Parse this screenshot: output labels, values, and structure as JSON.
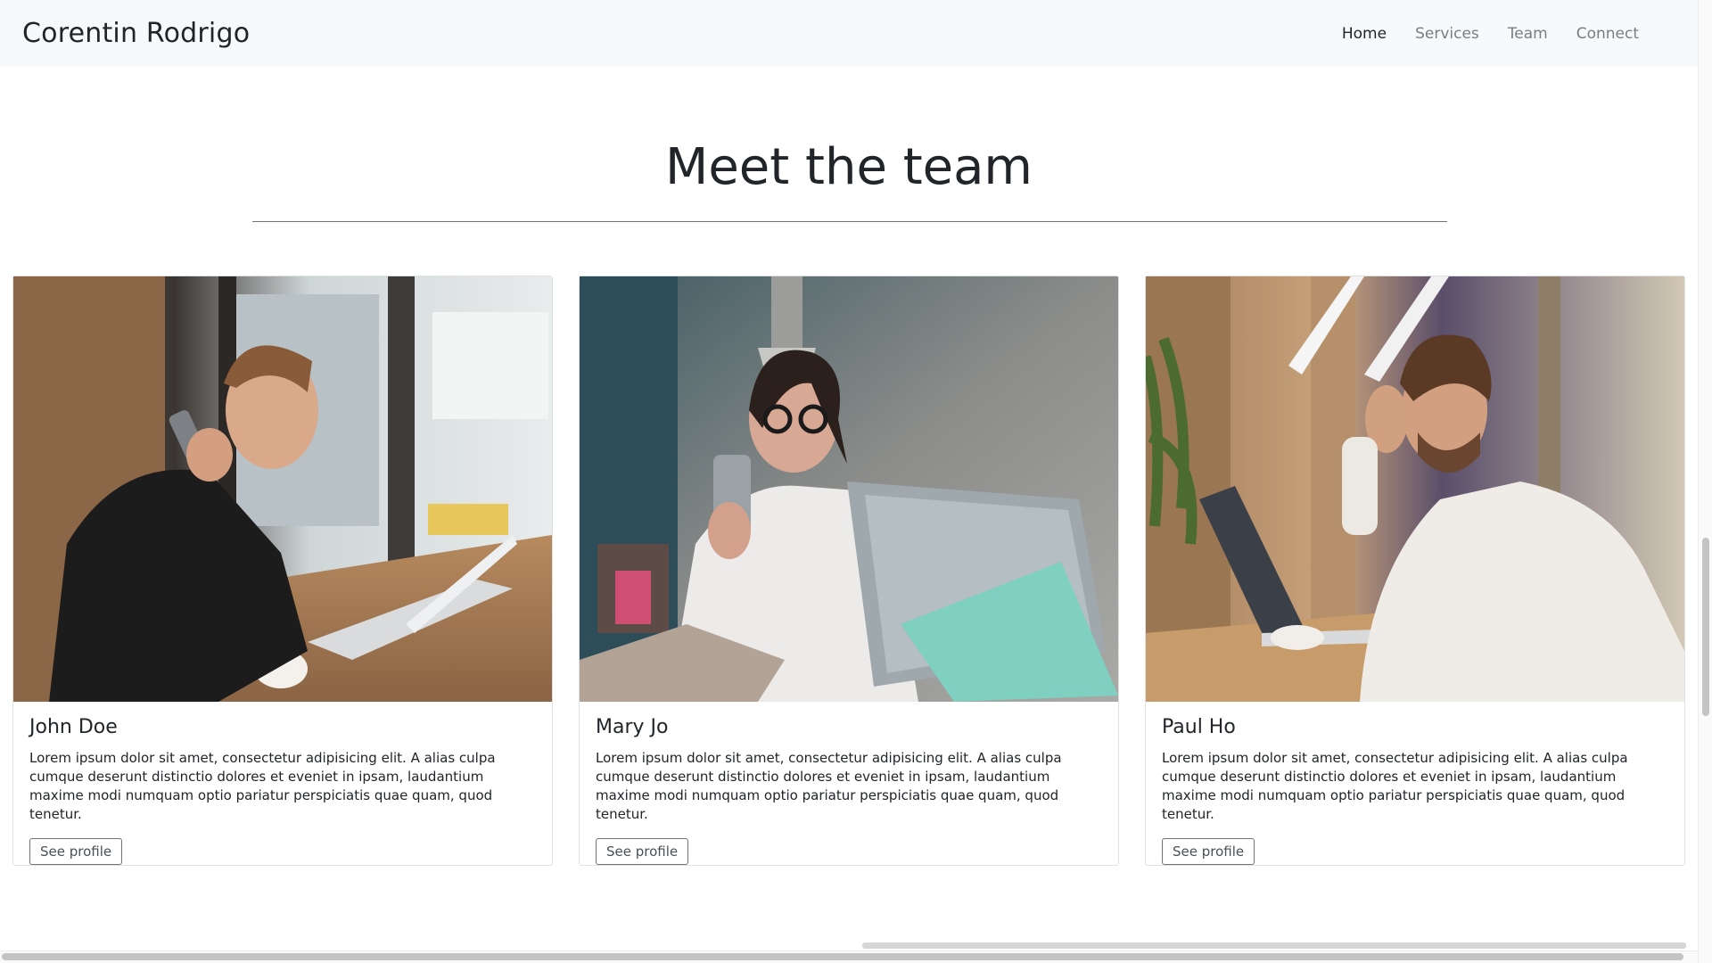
{
  "navbar": {
    "brand": "Corentin Rodrigo",
    "links": [
      {
        "label": "Home",
        "active": true
      },
      {
        "label": "Services",
        "active": false
      },
      {
        "label": "Team",
        "active": false
      },
      {
        "label": "Connect",
        "active": false
      }
    ]
  },
  "team_section": {
    "title": "Meet the team",
    "members": [
      {
        "name": "John Doe",
        "bio": "Lorem ipsum dolor sit amet, consectetur adipisicing elit. A alias culpa cumque deserunt distinctio dolores et eveniet in ipsam, laudantium maxime modi numquam optio pariatur perspiciatis quae quam, quod tenetur.",
        "button_label": "See profile"
      },
      {
        "name": "Mary Jo",
        "bio": "Lorem ipsum dolor sit amet, consectetur adipisicing elit. A alias culpa cumque deserunt distinctio dolores et eveniet in ipsam, laudantium maxime modi numquam optio pariatur perspiciatis quae quam, quod tenetur.",
        "button_label": "See profile"
      },
      {
        "name": "Paul Ho",
        "bio": "Lorem ipsum dolor sit amet, consectetur adipisicing elit. A alias culpa cumque deserunt distinctio dolores et eveniet in ipsam, laudantium maxime modi numquam optio pariatur perspiciatis quae quam, quod tenetur.",
        "button_label": "See profile"
      }
    ]
  },
  "colors": {
    "navbar_bg": "#f8f9fa",
    "text": "#212529",
    "nav_muted": "#7a7d80",
    "card_border": "#dfe2e5"
  }
}
